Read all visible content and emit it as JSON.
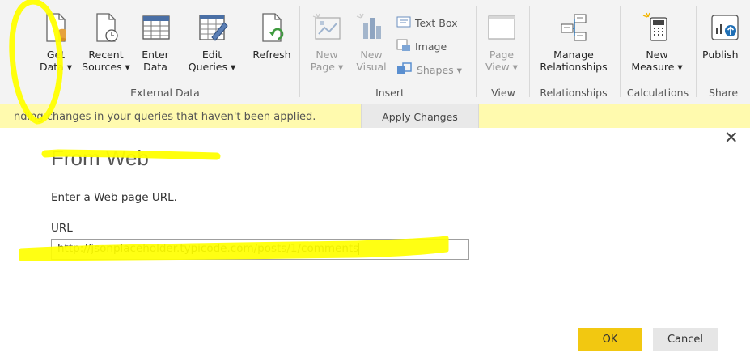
{
  "ribbon": {
    "get_data": {
      "line1": "Get",
      "line2": "Data ▾",
      "icon": "database-icon"
    },
    "recent_sources": {
      "line1": "Recent",
      "line2": "Sources ▾",
      "icon": "recent-sources-icon"
    },
    "enter_data": {
      "line1": "Enter",
      "line2": "Data",
      "icon": "table-icon"
    },
    "edit_queries": {
      "line1": "Edit",
      "line2": "Queries ▾",
      "icon": "edit-queries-icon"
    },
    "refresh": {
      "line1": "Refresh",
      "icon": "refresh-icon"
    },
    "new_page": {
      "line1": "New",
      "line2": "Page ▾",
      "icon": "new-page-icon"
    },
    "new_visual": {
      "line1": "New",
      "line2": "Visual",
      "icon": "new-visual-icon"
    },
    "text_box": {
      "label": "Text Box",
      "icon": "text-box-icon"
    },
    "image": {
      "label": "Image",
      "icon": "image-icon"
    },
    "shapes": {
      "label": "Shapes ▾",
      "icon": "shapes-icon"
    },
    "page_view": {
      "line1": "Page",
      "line2": "View ▾",
      "icon": "page-view-icon"
    },
    "manage_relationships": {
      "line1": "Manage",
      "line2": "Relationships",
      "icon": "relationships-icon"
    },
    "new_measure": {
      "line1": "New",
      "line2": "Measure ▾",
      "icon": "calculator-icon"
    },
    "publish": {
      "line1": "Publish",
      "icon": "publish-icon"
    },
    "groups": {
      "external_data": "External Data",
      "insert": "Insert",
      "view": "View",
      "relationships": "Relationships",
      "calculations": "Calculations",
      "share": "Share"
    }
  },
  "notification": {
    "text": "nding changes in your queries that haven't been applied.",
    "apply_label": "Apply Changes"
  },
  "dialog": {
    "close_glyph": "✕",
    "title": "From Web",
    "subtitle": "Enter a Web page URL.",
    "url_label": "URL",
    "url_value": "http://jsonplaceholder.typicode.com/posts/1/comments",
    "ok_label": "OK",
    "cancel_label": "Cancel"
  },
  "colors": {
    "ribbon_bg": "#f3f3f3",
    "notification_bg": "#fffaae",
    "ok_button": "#f2c811",
    "highlight": "#ffff00",
    "accent_green": "#3f9b3f",
    "accent_blue": "#1f6fb5"
  }
}
